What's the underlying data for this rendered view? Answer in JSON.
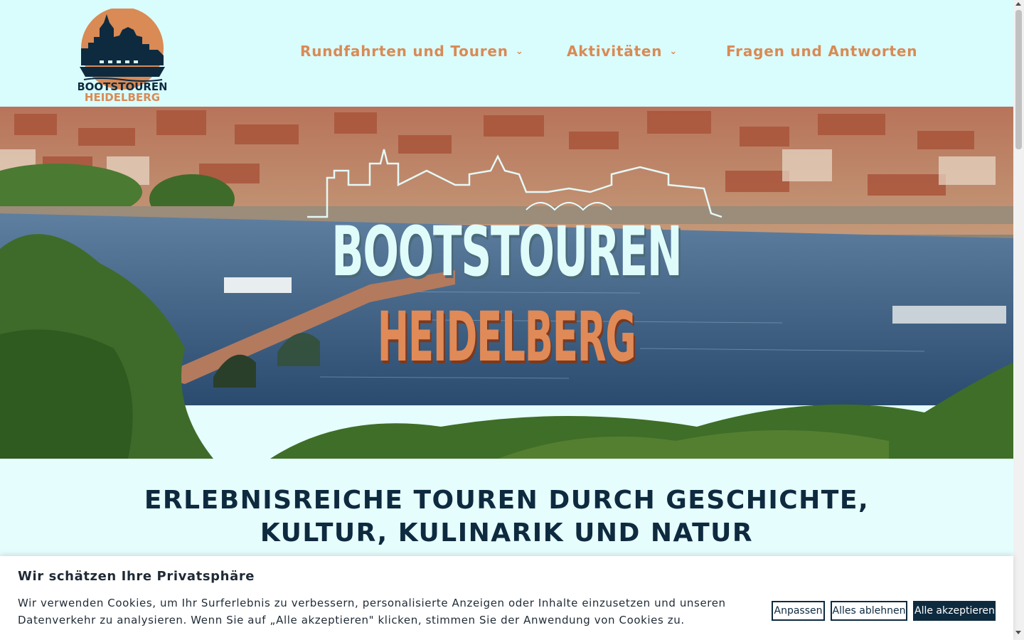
{
  "header": {
    "logo_text_line1": "BOOTSTOUREN",
    "logo_text_line2": "HEIDELBERG",
    "nav": [
      {
        "label": "Rundfahrten und Touren",
        "has_dropdown": true
      },
      {
        "label": "Aktivitäten",
        "has_dropdown": true
      },
      {
        "label": "Fragen und Antworten",
        "has_dropdown": false
      }
    ]
  },
  "hero": {
    "title_line1": "BOOTSTOUREN",
    "title_line2": "HEIDELBERG"
  },
  "main": {
    "headline": "ERLEBNISREICHE TOUREN DURCH GESCHICHTE, KULTUR, KULINARIK UND NATUR"
  },
  "cookie_banner": {
    "title": "Wir schätzen Ihre Privatsphäre",
    "text": "Wir verwenden Cookies, um Ihr Surferlebnis zu verbessern, personalisierte Anzeigen oder Inhalte einzusetzen und unseren Datenverkehr zu analysieren. Wenn Sie auf „Alle akzeptieren\" klicken, stimmen Sie der Anwendung von Cookies zu.",
    "buttons": {
      "customize": "Anpassen",
      "reject": "Alles ablehnen",
      "accept": "Alle akzeptieren"
    }
  },
  "colors": {
    "header_bg": "#d9fcfc",
    "nav_text": "#d98a55",
    "headline": "#0e2a3f",
    "accent_orange": "#e08a58",
    "dark_navy": "#0e2a3f"
  }
}
